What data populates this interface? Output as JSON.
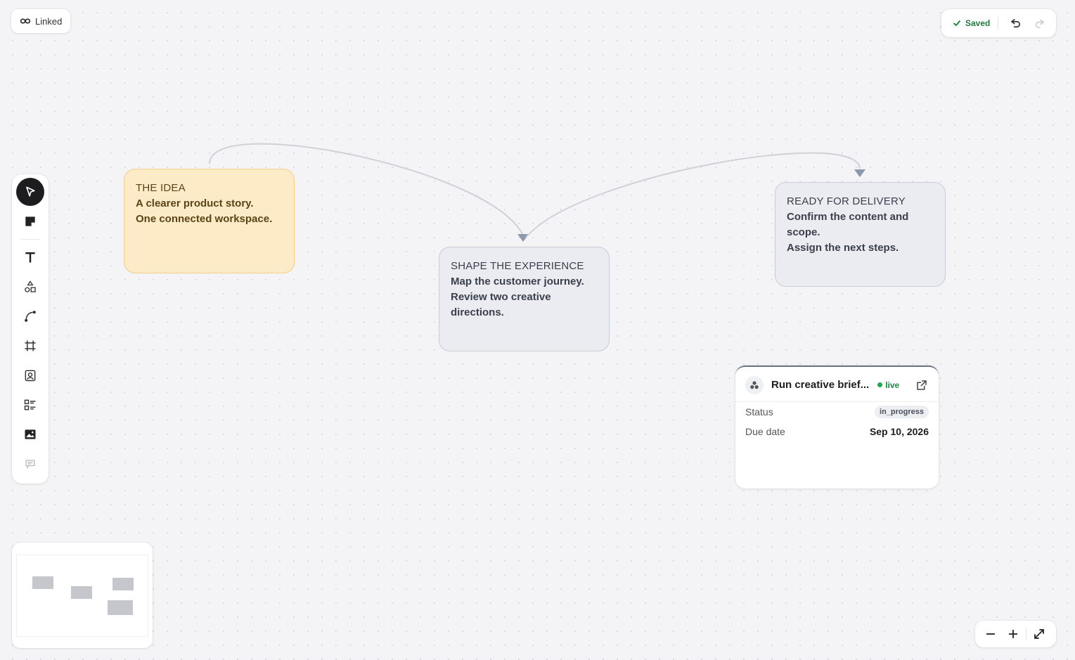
{
  "header": {
    "linked_label": "Linked",
    "saved_label": "Saved"
  },
  "toolbar": {
    "tools": [
      "select",
      "sticky-note",
      "text",
      "shapes",
      "connector",
      "frame",
      "contact-card",
      "list",
      "image",
      "comment"
    ],
    "active": "select"
  },
  "cards": {
    "idea": {
      "title": "THE IDEA",
      "line1": "A clearer product story.",
      "line2": "One connected workspace."
    },
    "shape": {
      "title": "SHAPE THE EXPERIENCE",
      "line1": "Map the customer journey.",
      "line2": "Review two creative",
      "line3": "directions."
    },
    "ready": {
      "title": "READY FOR DELIVERY",
      "line1": "Confirm the content and",
      "line2": "scope.",
      "line3": "Assign the next steps."
    }
  },
  "widget": {
    "title": "Run creative brief...",
    "live_label": "live",
    "status_label": "Status",
    "status_value": "in_progress",
    "due_label": "Due date",
    "due_value": "Sep 10, 2026"
  },
  "colors": {
    "sticky_bg": "#fdebc8",
    "sticky_border": "#f1cf8e",
    "card_bg": "#eaecf1",
    "live_green": "#22a651",
    "active_tool": "#1d1d1f"
  }
}
